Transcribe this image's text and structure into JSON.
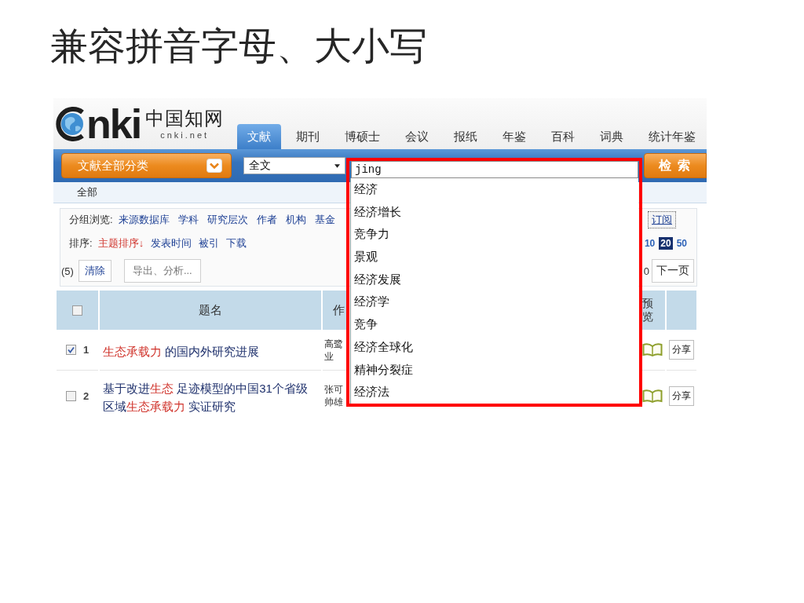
{
  "slide": {
    "title": "兼容拼音字母、大小写"
  },
  "logo": {
    "wordmark": "nki",
    "calligraphy": "中国知网",
    "domain": "cnki.net"
  },
  "tabs": [
    {
      "label": "文献",
      "selected": true
    },
    {
      "label": "期刊",
      "selected": false
    },
    {
      "label": "博硕士",
      "selected": false
    },
    {
      "label": "会议",
      "selected": false
    },
    {
      "label": "报纸",
      "selected": false
    },
    {
      "label": "年鉴",
      "selected": false
    },
    {
      "label": "百科",
      "selected": false
    },
    {
      "label": "词典",
      "selected": false
    },
    {
      "label": "统计年鉴",
      "selected": false
    }
  ],
  "search_bar": {
    "category": "文献全部分类",
    "field": "全文",
    "query": "jing",
    "button": "检 索"
  },
  "suggestions": [
    "经济",
    "经济增长",
    "竞争力",
    "景观",
    "经济发展",
    "经济学",
    "竞争",
    "经济全球化",
    "精神分裂症",
    "经济法"
  ],
  "breadcrumb": "全部",
  "group_browse": {
    "label": "分组浏览:",
    "links": [
      "来源数据库",
      "学科",
      "研究层次",
      "作者",
      "机构",
      "基金"
    ],
    "subscribe": "订阅"
  },
  "sort": {
    "label": "排序:",
    "options": [
      {
        "label": "主题排序↓",
        "selected": true
      },
      {
        "label": "发表时间",
        "selected": false
      },
      {
        "label": "被引",
        "selected": false
      },
      {
        "label": "下载",
        "selected": false
      }
    ],
    "page_sizes": [
      {
        "label": "10",
        "selected": false
      },
      {
        "label": "20",
        "selected": true
      },
      {
        "label": "50",
        "selected": false
      }
    ]
  },
  "actions": {
    "count": "(5)",
    "clear": "清除",
    "export": "导出、分析...",
    "page_info": "0",
    "next": "下一页"
  },
  "table": {
    "select_all": {
      "checked": false
    },
    "columns": {
      "title": "题名",
      "column_3": "作",
      "preview": "预览"
    },
    "rows": [
      {
        "checked": true,
        "number": "1",
        "title": [
          {
            "text": "生态承载力",
            "highlight": true
          },
          {
            "text": " 的国内外研究进展",
            "highlight": false
          }
        ],
        "column_3": [
          "高鹭",
          "业"
        ],
        "share": "分享"
      },
      {
        "checked": false,
        "number": "2",
        "title": [
          {
            "text": "基于改进",
            "highlight": false
          },
          {
            "text": "生态",
            "highlight": true
          },
          {
            "text": " 足迹模型的中国31个省级区域",
            "highlight": false
          },
          {
            "text": "生态承载力",
            "highlight": true
          },
          {
            "text": " 实证研究",
            "highlight": false
          }
        ],
        "column_3": [
          "张可",
          "帅雄"
        ],
        "share": "分享"
      }
    ]
  }
}
